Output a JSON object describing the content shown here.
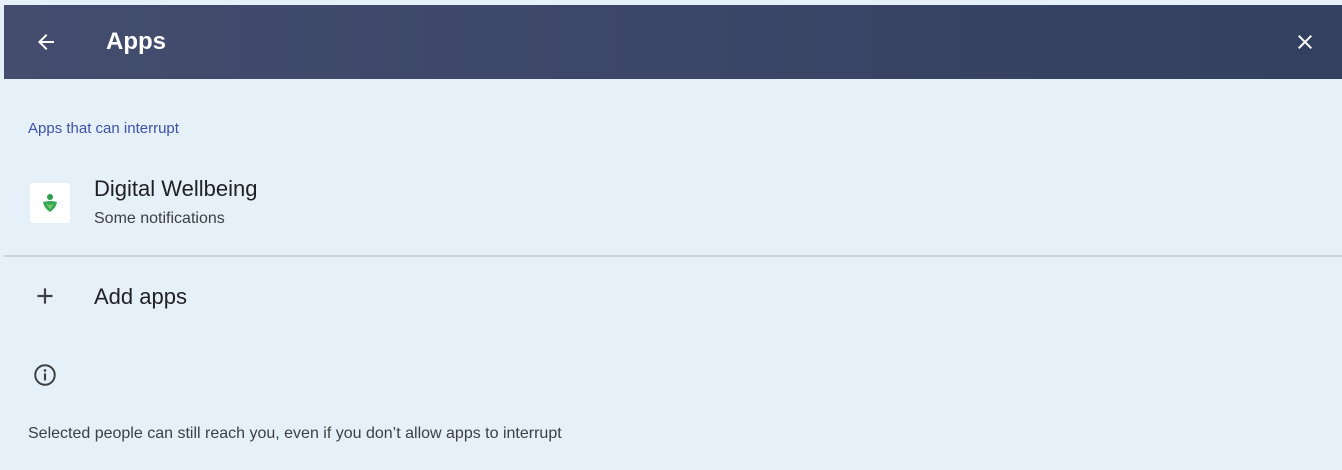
{
  "header": {
    "title": "Apps",
    "back_icon": "arrow-back-icon",
    "close_icon": "close-icon",
    "background_color": "#3c4668"
  },
  "section": {
    "header": "Apps that can interrupt"
  },
  "apps": [
    {
      "name": "Digital Wellbeing",
      "subtitle": "Some notifications",
      "icon": "digital-wellbeing-icon"
    }
  ],
  "add_apps": {
    "label": "Add apps",
    "icon": "plus-icon"
  },
  "info": {
    "icon": "info-icon",
    "text": "Selected people can still reach you, even if you don’t allow apps to interrupt"
  },
  "colors": {
    "accent": "#3f51a6",
    "background": "#e6f0f9"
  }
}
